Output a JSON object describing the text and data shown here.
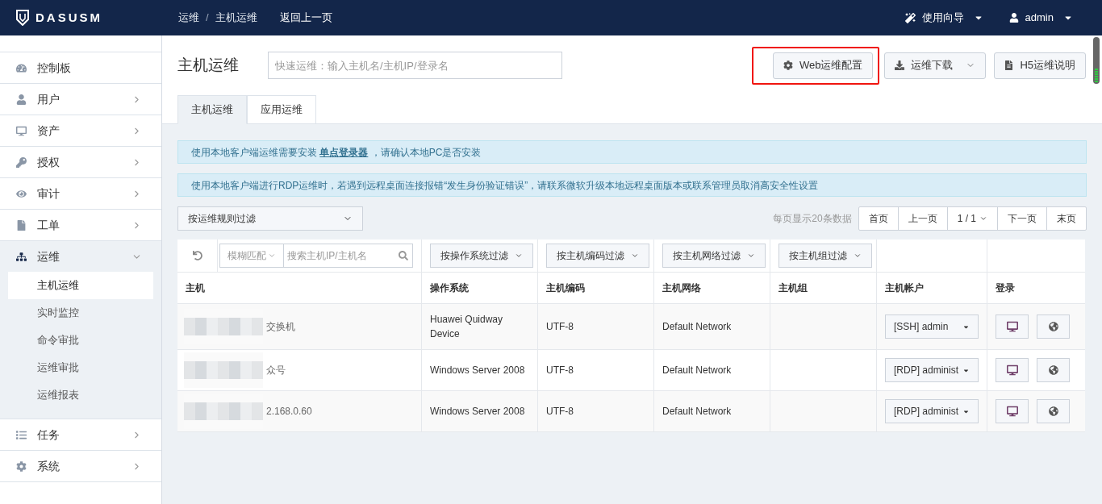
{
  "header": {
    "logo_text": "DASUSM",
    "breadcrumb": [
      "运维",
      "主机运维"
    ],
    "separator": "/",
    "back_link": "返回上一页",
    "guide_menu": "使用向导",
    "user_menu": "admin"
  },
  "sidebar": {
    "items": [
      {
        "label": "控制板",
        "expandable": false,
        "expanded": false
      },
      {
        "label": "用户",
        "expandable": true,
        "expanded": false
      },
      {
        "label": "资产",
        "expandable": true,
        "expanded": false
      },
      {
        "label": "授权",
        "expandable": true,
        "expanded": false
      },
      {
        "label": "审计",
        "expandable": true,
        "expanded": false
      },
      {
        "label": "工单",
        "expandable": true,
        "expanded": false
      },
      {
        "label": "运维",
        "expandable": true,
        "expanded": true,
        "children": [
          {
            "label": "主机运维",
            "selected": true
          },
          {
            "label": "实时监控",
            "selected": false
          },
          {
            "label": "命令审批",
            "selected": false
          },
          {
            "label": "运维审批",
            "selected": false
          },
          {
            "label": "运维报表",
            "selected": false
          }
        ]
      },
      {
        "label": "任务",
        "expandable": true,
        "expanded": false
      },
      {
        "label": "系统",
        "expandable": true,
        "expanded": false
      }
    ]
  },
  "page": {
    "title": "主机运维",
    "quick_search": {
      "placeholder": "快速运维：输入主机名/主机IP/登录名"
    },
    "buttons": [
      {
        "label": "Web运维配置",
        "highlighted": true,
        "dropdown": false
      },
      {
        "label": "运维下载",
        "highlighted": false,
        "dropdown": true
      },
      {
        "label": "H5运维说明",
        "highlighted": false,
        "dropdown": false
      }
    ],
    "tabs": [
      {
        "label": "主机运维",
        "selected": true
      },
      {
        "label": "应用运维",
        "selected": false
      }
    ]
  },
  "alerts": [
    {
      "text": "使用本地客户端运维需要安装",
      "link": "单点登录器",
      "after": "，请确认本地PC是否安装"
    },
    {
      "text": "使用本地客户端进行RDP运维时，若遇到远程桌面连接报错“发生身份验证错误”，请联系微软升级本地远程桌面版本或联系管理员取消高安全性设置"
    }
  ],
  "rule_filter": "按运维规则过滤",
  "pagination": {
    "per_page": "每页显示20条数据",
    "buttons": [
      "首页",
      "上一页"
    ],
    "page": "1 / 1",
    "after": [
      "下一页",
      "末页"
    ]
  },
  "table": {
    "match_mode": "模糊匹配",
    "search": {
      "placeholder": "搜索主机IP/主机名"
    },
    "filters": [
      "按操作系统过滤",
      "按主机编码过滤",
      "按主机网络过滤",
      "按主机组过滤"
    ],
    "columns": [
      "主机",
      "操作系统",
      "主机编码",
      "主机网络",
      "主机组",
      "主机帐户",
      "登录"
    ],
    "rows": [
      {
        "host": "交换机",
        "os": "Huawei Quidway Device",
        "encoding": "UTF-8",
        "network": "Default Network",
        "account": "[SSH] admin"
      },
      {
        "host": "众号",
        "os": "Windows Server 2008",
        "encoding": "UTF-8",
        "network": "Default Network",
        "account": "[RDP] administ"
      },
      {
        "host": "2.168.0.60",
        "os": "Windows Server 2008",
        "encoding": "UTF-8",
        "network": "Default Network",
        "account": "[RDP] administ"
      }
    ]
  }
}
